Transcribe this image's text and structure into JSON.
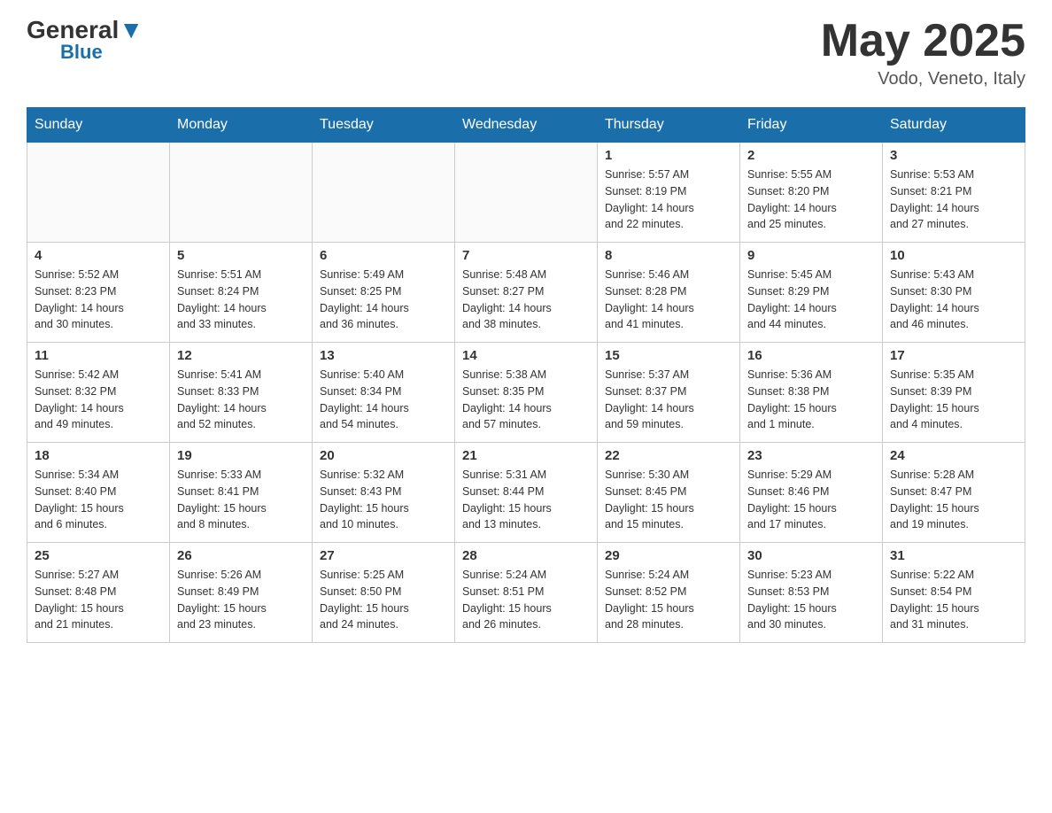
{
  "header": {
    "logo_general": "General",
    "logo_blue": "Blue",
    "month_year": "May 2025",
    "location": "Vodo, Veneto, Italy"
  },
  "weekdays": [
    "Sunday",
    "Monday",
    "Tuesday",
    "Wednesday",
    "Thursday",
    "Friday",
    "Saturday"
  ],
  "weeks": [
    [
      {
        "day": "",
        "info": ""
      },
      {
        "day": "",
        "info": ""
      },
      {
        "day": "",
        "info": ""
      },
      {
        "day": "",
        "info": ""
      },
      {
        "day": "1",
        "info": "Sunrise: 5:57 AM\nSunset: 8:19 PM\nDaylight: 14 hours\nand 22 minutes."
      },
      {
        "day": "2",
        "info": "Sunrise: 5:55 AM\nSunset: 8:20 PM\nDaylight: 14 hours\nand 25 minutes."
      },
      {
        "day": "3",
        "info": "Sunrise: 5:53 AM\nSunset: 8:21 PM\nDaylight: 14 hours\nand 27 minutes."
      }
    ],
    [
      {
        "day": "4",
        "info": "Sunrise: 5:52 AM\nSunset: 8:23 PM\nDaylight: 14 hours\nand 30 minutes."
      },
      {
        "day": "5",
        "info": "Sunrise: 5:51 AM\nSunset: 8:24 PM\nDaylight: 14 hours\nand 33 minutes."
      },
      {
        "day": "6",
        "info": "Sunrise: 5:49 AM\nSunset: 8:25 PM\nDaylight: 14 hours\nand 36 minutes."
      },
      {
        "day": "7",
        "info": "Sunrise: 5:48 AM\nSunset: 8:27 PM\nDaylight: 14 hours\nand 38 minutes."
      },
      {
        "day": "8",
        "info": "Sunrise: 5:46 AM\nSunset: 8:28 PM\nDaylight: 14 hours\nand 41 minutes."
      },
      {
        "day": "9",
        "info": "Sunrise: 5:45 AM\nSunset: 8:29 PM\nDaylight: 14 hours\nand 44 minutes."
      },
      {
        "day": "10",
        "info": "Sunrise: 5:43 AM\nSunset: 8:30 PM\nDaylight: 14 hours\nand 46 minutes."
      }
    ],
    [
      {
        "day": "11",
        "info": "Sunrise: 5:42 AM\nSunset: 8:32 PM\nDaylight: 14 hours\nand 49 minutes."
      },
      {
        "day": "12",
        "info": "Sunrise: 5:41 AM\nSunset: 8:33 PM\nDaylight: 14 hours\nand 52 minutes."
      },
      {
        "day": "13",
        "info": "Sunrise: 5:40 AM\nSunset: 8:34 PM\nDaylight: 14 hours\nand 54 minutes."
      },
      {
        "day": "14",
        "info": "Sunrise: 5:38 AM\nSunset: 8:35 PM\nDaylight: 14 hours\nand 57 minutes."
      },
      {
        "day": "15",
        "info": "Sunrise: 5:37 AM\nSunset: 8:37 PM\nDaylight: 14 hours\nand 59 minutes."
      },
      {
        "day": "16",
        "info": "Sunrise: 5:36 AM\nSunset: 8:38 PM\nDaylight: 15 hours\nand 1 minute."
      },
      {
        "day": "17",
        "info": "Sunrise: 5:35 AM\nSunset: 8:39 PM\nDaylight: 15 hours\nand 4 minutes."
      }
    ],
    [
      {
        "day": "18",
        "info": "Sunrise: 5:34 AM\nSunset: 8:40 PM\nDaylight: 15 hours\nand 6 minutes."
      },
      {
        "day": "19",
        "info": "Sunrise: 5:33 AM\nSunset: 8:41 PM\nDaylight: 15 hours\nand 8 minutes."
      },
      {
        "day": "20",
        "info": "Sunrise: 5:32 AM\nSunset: 8:43 PM\nDaylight: 15 hours\nand 10 minutes."
      },
      {
        "day": "21",
        "info": "Sunrise: 5:31 AM\nSunset: 8:44 PM\nDaylight: 15 hours\nand 13 minutes."
      },
      {
        "day": "22",
        "info": "Sunrise: 5:30 AM\nSunset: 8:45 PM\nDaylight: 15 hours\nand 15 minutes."
      },
      {
        "day": "23",
        "info": "Sunrise: 5:29 AM\nSunset: 8:46 PM\nDaylight: 15 hours\nand 17 minutes."
      },
      {
        "day": "24",
        "info": "Sunrise: 5:28 AM\nSunset: 8:47 PM\nDaylight: 15 hours\nand 19 minutes."
      }
    ],
    [
      {
        "day": "25",
        "info": "Sunrise: 5:27 AM\nSunset: 8:48 PM\nDaylight: 15 hours\nand 21 minutes."
      },
      {
        "day": "26",
        "info": "Sunrise: 5:26 AM\nSunset: 8:49 PM\nDaylight: 15 hours\nand 23 minutes."
      },
      {
        "day": "27",
        "info": "Sunrise: 5:25 AM\nSunset: 8:50 PM\nDaylight: 15 hours\nand 24 minutes."
      },
      {
        "day": "28",
        "info": "Sunrise: 5:24 AM\nSunset: 8:51 PM\nDaylight: 15 hours\nand 26 minutes."
      },
      {
        "day": "29",
        "info": "Sunrise: 5:24 AM\nSunset: 8:52 PM\nDaylight: 15 hours\nand 28 minutes."
      },
      {
        "day": "30",
        "info": "Sunrise: 5:23 AM\nSunset: 8:53 PM\nDaylight: 15 hours\nand 30 minutes."
      },
      {
        "day": "31",
        "info": "Sunrise: 5:22 AM\nSunset: 8:54 PM\nDaylight: 15 hours\nand 31 minutes."
      }
    ]
  ]
}
